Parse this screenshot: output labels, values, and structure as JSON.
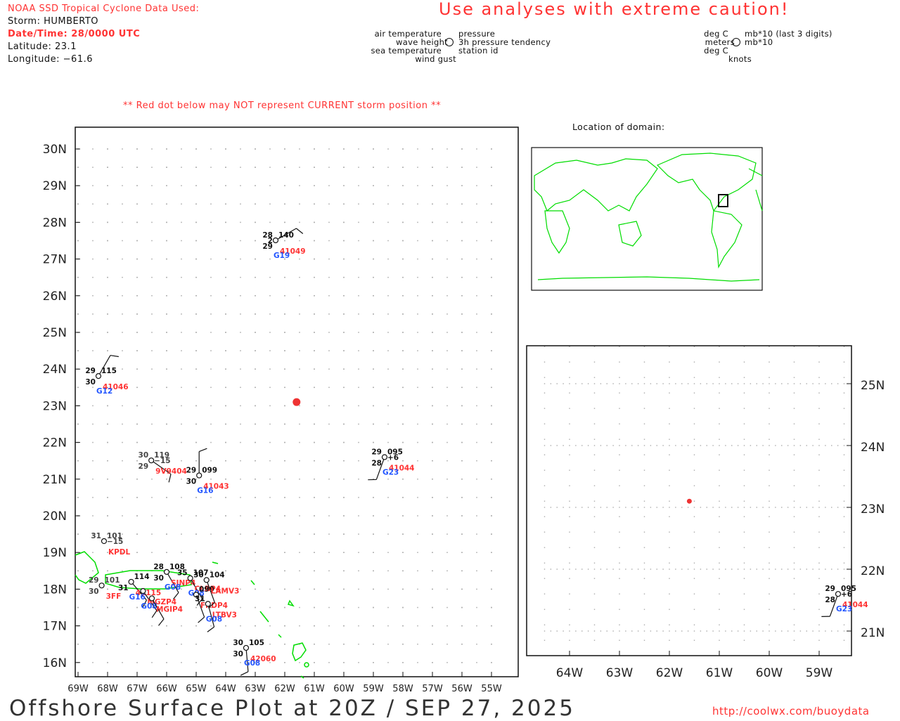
{
  "header": {
    "source": "NOAA SSD Tropical Cyclone Data Used:",
    "storm": "Storm: HUMBERTO",
    "datetime": "Date/Time: 28/0000 UTC",
    "latitude": "Latitude: 23.1",
    "longitude": "Longitude: −61.6",
    "caution": "Use analyses with extreme caution!",
    "note": "** Red dot below may NOT represent CURRENT storm position **"
  },
  "legend": {
    "left": [
      "air temperature",
      "wave height",
      "sea temperature",
      "wind gust"
    ],
    "right": [
      "pressure",
      "3h pressure tendency",
      "station id"
    ],
    "units_left": [
      "deg C",
      "meters",
      "deg C",
      "knots"
    ],
    "units_right": [
      "mb*10 (last 3 digits)",
      "mb*10"
    ]
  },
  "domain_title": "Location of domain:",
  "footer": {
    "title": "Offshore Surface Plot at 20Z / SEP 27, 2025",
    "url": "http://coolwx.com/buoydata"
  },
  "storm_position": {
    "lat": 23.1,
    "lon": -61.6
  },
  "main_axes": {
    "lat_labels": [
      "30N",
      "29N",
      "28N",
      "27N",
      "26N",
      "25N",
      "24N",
      "23N",
      "22N",
      "21N",
      "20N",
      "19N",
      "18N",
      "17N",
      "16N"
    ],
    "lon_labels": [
      "69W",
      "68W",
      "67W",
      "66W",
      "65W",
      "64W",
      "63W",
      "62W",
      "61W",
      "60W",
      "59W",
      "58W",
      "57W",
      "56W",
      "55W"
    ]
  },
  "inset_axes": {
    "lat_labels": [
      "25N",
      "24N",
      "23N",
      "22N",
      "21N"
    ],
    "lon_labels": [
      "64W",
      "63W",
      "62W",
      "61W",
      "60W",
      "59W"
    ]
  },
  "stations": [
    {
      "id": "41049",
      "lat": 27.51,
      "lon": -62.31,
      "air": "28",
      "wave": "2",
      "sea": "29",
      "pres": "140",
      "tend": "",
      "gust": "G19",
      "wdir": 60,
      "color": "#111"
    },
    {
      "id": "41046",
      "lat": 23.81,
      "lon": -68.31,
      "air": "29",
      "wave": "",
      "sea": "30",
      "pres": "115",
      "tend": "",
      "gust": "G12",
      "wdir": 30,
      "color": "#111"
    },
    {
      "id": "9V9404",
      "lat": 21.51,
      "lon": -66.52,
      "air": "30",
      "wave": "",
      "sea": "29",
      "pres": "119",
      "tend": "−15",
      "gust": "",
      "wdir": 125,
      "color": "#444"
    },
    {
      "id": "41043",
      "lat": 21.1,
      "lon": -64.9,
      "air": "29",
      "wave": "",
      "sea": "30",
      "pres": "099",
      "tend": "",
      "gust": "G16",
      "wdir": 0,
      "color": "#111"
    },
    {
      "id": "41044",
      "lat": 21.6,
      "lon": -58.62,
      "air": "29",
      "wave": "",
      "sea": "28",
      "pres": "095",
      "tend": "+6",
      "gust": "G23",
      "wdir": 200,
      "color": "#111"
    },
    {
      "id": "KPDL",
      "lat": 19.31,
      "lon": -68.12,
      "air": "31",
      "wave": "",
      "sea": "",
      "pres": "101",
      "tend": "−15",
      "gust": "",
      "wdir": 0,
      "color": "#444"
    },
    {
      "id": "42060",
      "lat": 16.4,
      "lon": -63.31,
      "air": "30",
      "wave": "",
      "sea": "30",
      "pres": "105",
      "tend": "",
      "gust": "G08",
      "wdir": 175,
      "color": "#111"
    },
    {
      "id": "SJNP4",
      "lat": 18.47,
      "lon": -66.0,
      "air": "28",
      "wave": "",
      "sea": "30",
      "pres": "108",
      "tend": "",
      "gust": "G08",
      "wdir": 150,
      "color": "#111"
    },
    {
      "id": "41115",
      "lat": 18.2,
      "lon": -67.2,
      "air": "",
      "wave": "",
      "sea": "31",
      "pres": "114",
      "tend": "",
      "gust": "G16",
      "wdir": 140,
      "color": "#111"
    },
    {
      "id": "MGZP4",
      "lat": 17.95,
      "lon": -66.8,
      "air": "",
      "wave": "",
      "sea": "",
      "pres": "",
      "tend": "",
      "gust": "G08",
      "wdir": 145,
      "color": "#111"
    },
    {
      "id": "MGIP4",
      "lat": 17.75,
      "lon": -66.5,
      "air": "",
      "wave": "",
      "sea": "",
      "pres": "",
      "tend": "",
      "gust": "",
      "wdir": 150,
      "color": "#111"
    },
    {
      "id": "CLBP4",
      "lat": 18.3,
      "lon": -65.2,
      "air": "35",
      "wave": "",
      "sea": "",
      "pres": "107",
      "tend": "",
      "gust": "G08",
      "wdir": 150,
      "color": "#111"
    },
    {
      "id": "FRDP4",
      "lat": 17.85,
      "lon": -65.0,
      "air": "",
      "wave": "",
      "sea": "",
      "pres": "099",
      "tend": "",
      "gust": "",
      "wdir": 160,
      "color": "#111"
    },
    {
      "id": "LAMV3",
      "lat": 18.25,
      "lon": -64.65,
      "air": "30",
      "wave": "",
      "sea": "",
      "pres": "104",
      "tend": "",
      "gust": "",
      "wdir": 160,
      "color": "#111"
    },
    {
      "id": "LTBV3",
      "lat": 17.6,
      "lon": -64.6,
      "air": "31",
      "wave": "",
      "sea": "",
      "pres": "",
      "tend": "",
      "gust": "G08",
      "wdir": 165,
      "color": "#111"
    },
    {
      "id": "3FF",
      "lat": 18.1,
      "lon": -68.2,
      "air": "29",
      "wave": "",
      "sea": "30",
      "pres": "101",
      "tend": "",
      "gust": "",
      "wdir": 0,
      "color": "#444"
    }
  ],
  "colors": {
    "land": "#00dd00",
    "storm": "#ee3333",
    "id": "#ff3333",
    "gust": "#2255ff"
  }
}
